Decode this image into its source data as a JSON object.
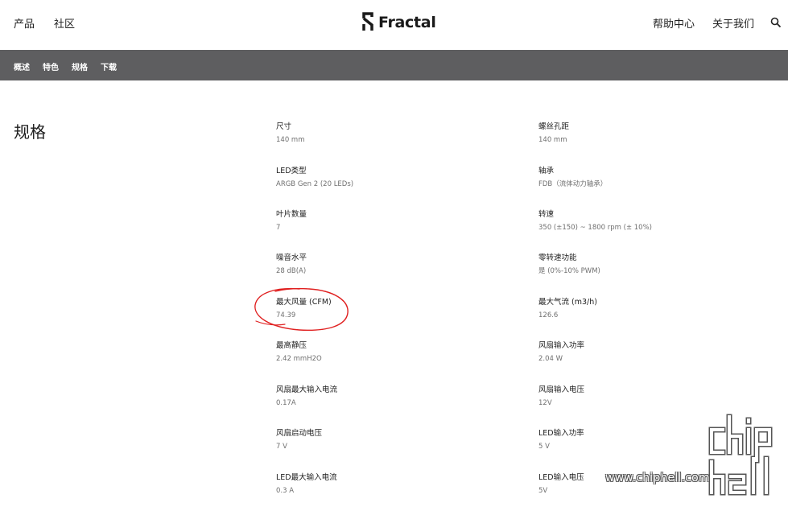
{
  "header": {
    "nav_left": [
      "产品",
      "社区"
    ],
    "brand": "Fractal",
    "nav_right": [
      "帮助中心",
      "关于我们"
    ],
    "search_icon": "search-icon"
  },
  "subnav": [
    "概述",
    "特色",
    "规格",
    "下载"
  ],
  "section_title": "规格",
  "specs_left": [
    {
      "label": "尺寸",
      "value": "140 mm"
    },
    {
      "label": "LED类型",
      "value": "ARGB Gen 2 (20 LEDs)"
    },
    {
      "label": "叶片数量",
      "value": "7"
    },
    {
      "label": "噪音水平",
      "value": "28 dB(A)"
    },
    {
      "label": "最大风量 (CFM)",
      "value": "74.39"
    },
    {
      "label": "最高静压",
      "value": "2.42 mmH2O"
    },
    {
      "label": "风扇最大输入电流",
      "value": "0.17A"
    },
    {
      "label": "风扇启动电压",
      "value": "7 V"
    },
    {
      "label": "LED最大输入电流",
      "value": "0.3 A"
    }
  ],
  "specs_right": [
    {
      "label": "螺丝孔距",
      "value": "140 mm"
    },
    {
      "label": "轴承",
      "value": "FDB（流体动力轴承）"
    },
    {
      "label": "转速",
      "value": "350 (±150) ~ 1800 rpm (± 10%)"
    },
    {
      "label": "零转速功能",
      "value": "是 (0%-10% PWM)"
    },
    {
      "label": "最大气流 (m3/h)",
      "value": "126.6"
    },
    {
      "label": "风扇输入功率",
      "value": "2.04 W"
    },
    {
      "label": "风扇输入电压",
      "value": "12V"
    },
    {
      "label": "LED输入功率",
      "value": "5 V"
    },
    {
      "label": "LED输入电压",
      "value": "5V"
    }
  ],
  "watermark": "www.chiphell.com",
  "colors": {
    "subnav_bg": "#5e5e60",
    "annotation": "#e02020"
  }
}
